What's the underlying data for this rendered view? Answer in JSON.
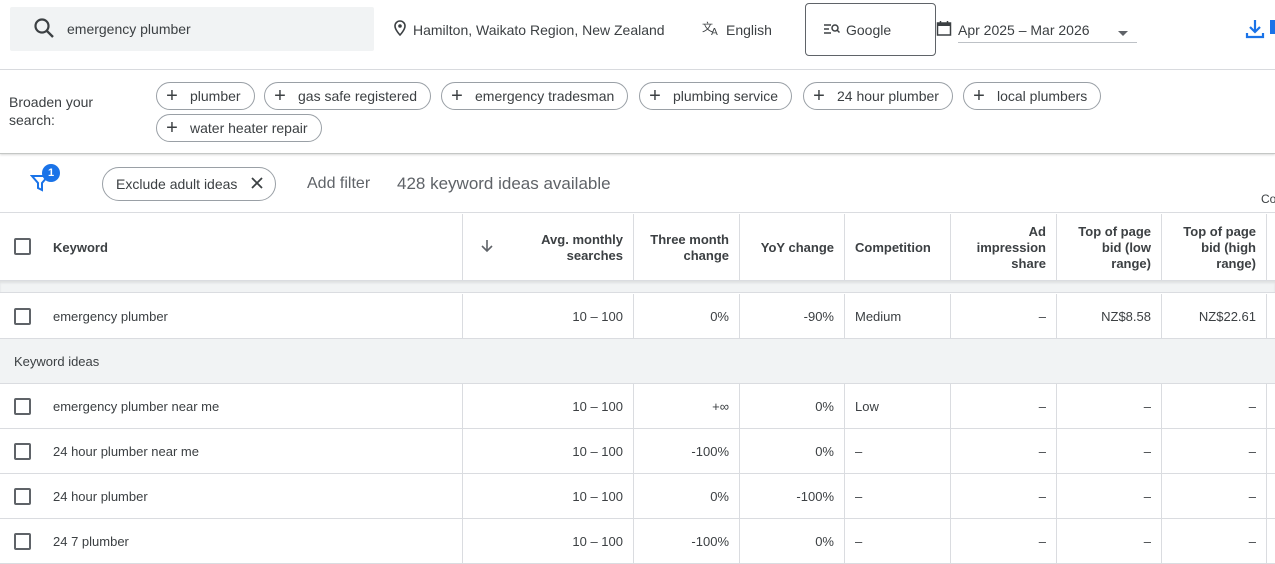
{
  "search": {
    "query": "emergency plumber"
  },
  "location": "Hamilton, Waikato Region, New Zealand",
  "language": "English",
  "network": "Google",
  "date_range": "Apr 2025 – Mar 2026",
  "broaden": {
    "label": "Broaden your search:",
    "chips": [
      "plumber",
      "gas safe registered",
      "emergency tradesman",
      "plumbing service",
      "24 hour plumber",
      "local plumbers",
      "water heater repair"
    ]
  },
  "filters": {
    "badge_count": "1",
    "exclude_chip": "Exclude adult ideas",
    "add_filter": "Add filter",
    "ideas_count": "428 keyword ideas available",
    "cut_column": "Co"
  },
  "table": {
    "headers": {
      "keyword": "Keyword",
      "avg_monthly": "Avg. monthly searches",
      "three_month": "Three month change",
      "yoy": "YoY change",
      "competition": "Competition",
      "ad_impression": "Ad impression share",
      "top_low": "Top of page bid (low range)",
      "top_high": "Top of page bid (high range)"
    },
    "provided": [
      {
        "keyword": "emergency plumber",
        "avg": "10 – 100",
        "three": "0%",
        "yoy": "-90%",
        "comp": "Medium",
        "ad": "–",
        "low": "NZ$8.58",
        "high": "NZ$22.61"
      }
    ],
    "section_label": "Keyword ideas",
    "ideas": [
      {
        "keyword": "emergency plumber near me",
        "avg": "10 – 100",
        "three": "+∞",
        "yoy": "0%",
        "comp": "Low",
        "ad": "–",
        "low": "–",
        "high": "–"
      },
      {
        "keyword": "24 hour plumber near me",
        "avg": "10 – 100",
        "three": "-100%",
        "yoy": "0%",
        "comp": "–",
        "ad": "–",
        "low": "–",
        "high": "–"
      },
      {
        "keyword": "24 hour plumber",
        "avg": "10 – 100",
        "three": "0%",
        "yoy": "-100%",
        "comp": "–",
        "ad": "–",
        "low": "–",
        "high": "–"
      },
      {
        "keyword": "24 7 plumber",
        "avg": "10 – 100",
        "three": "-100%",
        "yoy": "0%",
        "comp": "–",
        "ad": "–",
        "low": "–",
        "high": "–"
      }
    ]
  },
  "colors": {
    "accent": "#1a73e8",
    "border": "#dadce0",
    "section_bg": "#f1f3f4"
  }
}
